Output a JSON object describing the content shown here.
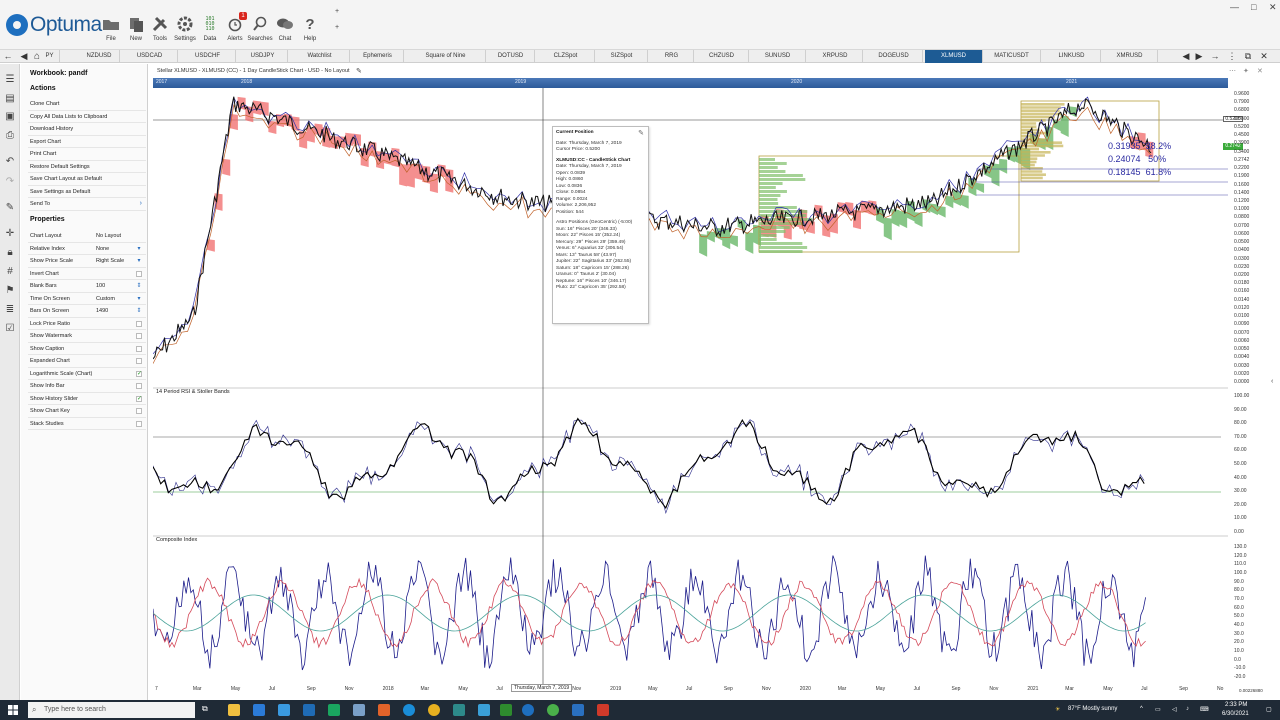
{
  "app": {
    "brand": "Optuma"
  },
  "toolbar": {
    "buttons": [
      {
        "label": "File",
        "icon": "folder-icon"
      },
      {
        "label": "New",
        "icon": "new-document-icon"
      },
      {
        "label": "Tools",
        "icon": "tools-icon"
      },
      {
        "label": "Settings",
        "icon": "settings-gear-icon"
      },
      {
        "label": "Data",
        "icon": "data-binary-icon"
      },
      {
        "label": "Alerts",
        "icon": "alarm-clock-icon",
        "badge": "1"
      },
      {
        "label": "Searches",
        "icon": "magnifier-icon"
      },
      {
        "label": "Chat",
        "icon": "chat-bubbles-icon"
      },
      {
        "label": "Help",
        "icon": "help-question-icon"
      }
    ]
  },
  "tabs": [
    "PY",
    "NZDUSD",
    "USDCAD",
    "USDCHF",
    "USDJPY",
    "Watchlist",
    "Ephemeris",
    "Square of Nine",
    "DOTUSD",
    "CLZSpot",
    "SIZSpot",
    "RRG",
    "CHZUSD",
    "SUNUSD",
    "XRPUSD",
    "DOGEUSD",
    "XLMUSD",
    "MATICUSDT",
    "LINKUSD",
    "XMRUSD"
  ],
  "active_tab": "XLMUSD",
  "sidepanel": {
    "workbook": "Workbook: pandf",
    "actions_title": "Actions",
    "actions": [
      "Clone Chart",
      "Copy All Data Lists to Clipboard",
      "Download History",
      "Export Chart",
      "Print Chart",
      "Restore Default Settings",
      "Save Chart Layout as Default",
      "Save Settings as Default",
      "Send To"
    ],
    "properties_title": "Properties",
    "properties": [
      {
        "label": "Chart Layout",
        "value": "No Layout",
        "ctrl": ""
      },
      {
        "label": "Relative Index",
        "value": "None",
        "ctrl": "dropdown"
      },
      {
        "label": "Show Price Scale",
        "value": "Right Scale",
        "ctrl": "dropdown"
      },
      {
        "label": "Invert Chart",
        "value": "",
        "ctrl": "check"
      },
      {
        "label": "Blank Bars",
        "value": "100",
        "ctrl": "spin"
      },
      {
        "label": "Time On Screen",
        "value": "Custom",
        "ctrl": "dropdown"
      },
      {
        "label": "Bars On Screen",
        "value": "1490",
        "ctrl": "spin"
      },
      {
        "label": "Lock Price Ratio",
        "value": "",
        "ctrl": "check"
      },
      {
        "label": "Show Watermark",
        "value": "",
        "ctrl": "check"
      },
      {
        "label": "Show Caption",
        "value": "",
        "ctrl": "check"
      },
      {
        "label": "Expanded Chart",
        "value": "",
        "ctrl": "check"
      },
      {
        "label": "Logarithmic Scale (Chart)",
        "value": "",
        "ctrl": "checked"
      },
      {
        "label": "Show Info Bar",
        "value": "",
        "ctrl": "check"
      },
      {
        "label": "Show History Slider",
        "value": "",
        "ctrl": "checked"
      },
      {
        "label": "Show Chart Key",
        "value": "",
        "ctrl": "check"
      },
      {
        "label": "Stack Studies",
        "value": "",
        "ctrl": "check"
      }
    ]
  },
  "chart": {
    "title": "Stellar XLMUSD - XLMUSD (CC) - 1 Day CandleStick Chart - USD - No Layout",
    "history_labels": [
      "2017",
      "2018",
      "2019",
      "2020",
      "2021"
    ],
    "price_axis": [
      "0.9600",
      "0.7900",
      "0.6800",
      "0.5800",
      "0.5200",
      "0.4500",
      "0.3900",
      "0.3400",
      "0.2742",
      "0.2200",
      "0.1900",
      "0.1600",
      "0.1400",
      "0.1200",
      "0.1000",
      "0.0800",
      "0.0700",
      "0.0600",
      "0.0500",
      "0.0400",
      "0.0300",
      "0.0230",
      "0.0200",
      "0.0180",
      "0.0160",
      "0.0140",
      "0.0120",
      "0.0100",
      "0.0090",
      "0.0070",
      "0.0060",
      "0.0050",
      "0.0040",
      "0.0030",
      "0.0020",
      "0.0000"
    ],
    "current_price": "0.5200",
    "last_price": "0.2742",
    "fib": [
      {
        "price": "0.31935",
        "pct": "38.2%"
      },
      {
        "price": "0.24074",
        "pct": "50%"
      },
      {
        "price": "0.18145",
        "pct": "61.8%"
      }
    ],
    "popup": {
      "title": "Current Position",
      "date": "Date: Thursday, March 7, 2019",
      "cursor_price": "Cursor Price: 0.5200",
      "series": "XLMUSD:CC - CandleStick Chart",
      "ohlc": [
        "Date: Thursday, March 7, 2019",
        "Open: 0.0839",
        "High: 0.0860",
        "Low: 0.0836",
        "Close: 0.0854",
        "Range: 0.0024",
        "Volume: 2,206,952",
        "Position: 544"
      ],
      "astro_title": "Astro Positions (GeoCentric) (-5:00)",
      "astro": [
        "Sun: 16° Pisces 20' (346.33)",
        "Moon: 22° Pisces 15' (352.24)",
        "Mercury: 29° Pisces 29' (359.49)",
        "Venus: 6° Aquarius 32' (306.54)",
        "Mars: 13° Taurus 58' (43.97)",
        "Jupiter: 22° Sagittarius 33' (262.55)",
        "Saturn: 18° Capricorn 15' (288.26)",
        "Uranus: 0° Taurus 2' (30.04)",
        "Neptune: 16° Pisces 10' (346.17)",
        "Pluto: 22° Capricorn 35' (292.58)"
      ]
    },
    "rsi": {
      "title": "14 Period RSI & Stoller Bands",
      "axis": [
        "100.00",
        "90.00",
        "80.00",
        "70.00",
        "60.00",
        "50.00",
        "40.00",
        "30.00",
        "20.00",
        "10.00",
        "0.00"
      ]
    },
    "composite": {
      "title": "Composite Index",
      "axis": [
        "130.0",
        "120.0",
        "110.0",
        "100.0",
        "90.0",
        "80.0",
        "70.0",
        "60.0",
        "50.0",
        "40.0",
        "30.0",
        "20.0",
        "10.0",
        "0.0",
        "-10.0",
        "-20.0"
      ]
    },
    "date_axis": [
      "7",
      "Mar",
      "May",
      "Jul",
      "Sep",
      "Nov",
      "2018",
      "Mar",
      "May",
      "Jul",
      "Sep",
      "Nov",
      "2019",
      "May",
      "Jul",
      "Sep",
      "Nov",
      "2020",
      "Mar",
      "May",
      "Jul",
      "Sep",
      "Nov",
      "2021",
      "Mar",
      "May",
      "Jul",
      "Sep",
      "No"
    ],
    "cursor_date": "Thursday, March 7, 2019",
    "corner_value": "0.00226880"
  },
  "taskbar": {
    "search_placeholder": "Type here to search",
    "weather": "87°F  Mostly sunny",
    "time": "2:33 PM",
    "date": "6/30/2021"
  },
  "colors": {
    "accent": "#1d5b94",
    "cloud_bear": "#f06a6a",
    "cloud_bull": "#5fb35f",
    "price_line": "#111111",
    "rsi_line": "#000000",
    "stoller_line": "#2d2d8c",
    "composite_fast": "#1c1c8a",
    "composite_slow": "#d44a5a",
    "composite_avg": "#4aa39a"
  }
}
